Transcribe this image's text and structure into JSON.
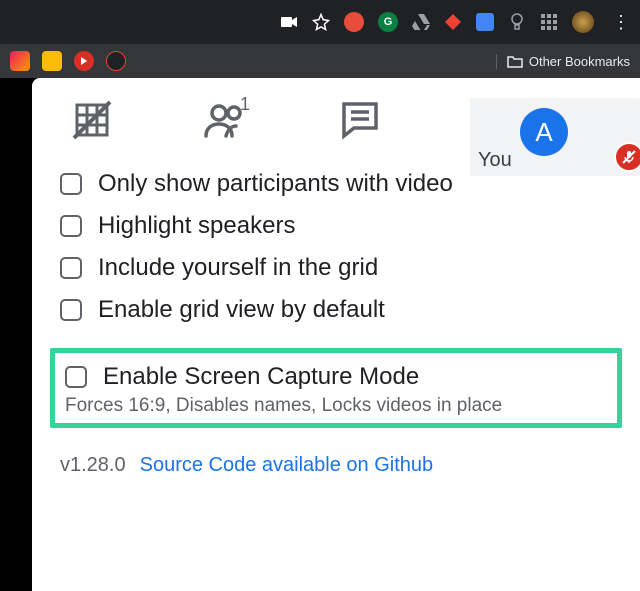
{
  "browser": {
    "bookmarks_label": "Other Bookmarks"
  },
  "you": {
    "label": "You",
    "avatar_letter": "A"
  },
  "people_badge": "1",
  "options": [
    {
      "label": "Only show participants with video"
    },
    {
      "label": "Highlight speakers"
    },
    {
      "label": "Include yourself in the grid"
    },
    {
      "label": "Enable grid view by default"
    }
  ],
  "highlight": {
    "label": "Enable Screen Capture Mode",
    "sub": "Forces 16:9, Disables names, Locks videos in place"
  },
  "footer": {
    "version": "v1.28.0",
    "source": "Source Code available on Github"
  }
}
